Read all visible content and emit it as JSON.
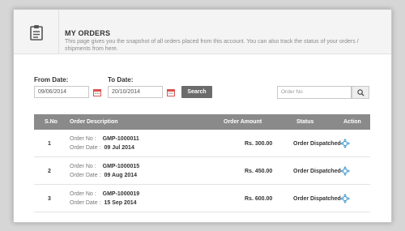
{
  "header": {
    "title": "MY ORDERS",
    "description": "This page gives you the snapshot of all orders placed from this account. You can also track the status of your orders / shipments from here."
  },
  "filters": {
    "from_label": "From Date:",
    "from_value": "09/06/2014",
    "to_label": "To Date:",
    "to_value": "20/10/2014",
    "search_label": "Search",
    "order_no_placeholder": "Order No"
  },
  "table": {
    "headers": {
      "sno": "S.No",
      "description": "Order Description",
      "amount": "Order Amount",
      "status": "Status",
      "action": "Action"
    },
    "rows": [
      {
        "sno": "1",
        "order_no_label": "Order No :",
        "order_no": "GMP-1000011",
        "order_date_label": "Order Date :",
        "order_date": "09 Jul 2014",
        "amount": "Rs. 300.00",
        "status": "Order Dispatched"
      },
      {
        "sno": "2",
        "order_no_label": "Order No :",
        "order_no": "GMP-1000015",
        "order_date_label": "Order Date :",
        "order_date": "09 Aug 2014",
        "amount": "Rs. 450.00",
        "status": "Order Dispatched"
      },
      {
        "sno": "3",
        "order_no_label": "Order No :",
        "order_no": "GMP-1000019",
        "order_date_label": "Order Date :",
        "order_date": "15 Sep 2014",
        "amount": "Rs. 600.00",
        "status": "Order Dispatched"
      }
    ]
  },
  "icons": {
    "header": "clipboard-icon",
    "calendar": "calendar-icon",
    "search": "magnifier-icon",
    "action": "move-arrows-icon"
  },
  "colors": {
    "table_header": "#8a8a8a",
    "search_button": "#6b6b6b",
    "calendar_accent": "#d9534f",
    "action_icon": "#4a9fd8"
  }
}
